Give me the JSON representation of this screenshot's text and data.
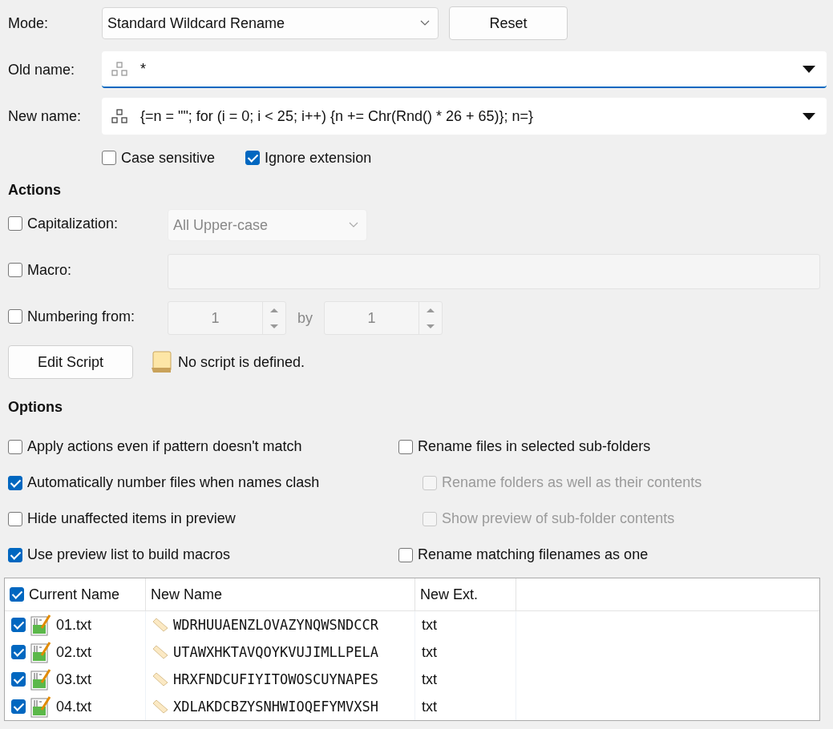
{
  "mode": {
    "label": "Mode:",
    "value": "Standard Wildcard Rename"
  },
  "reset_button": "Reset",
  "name_fields": [
    {
      "label": "Old name:",
      "value": "*",
      "focused": true
    },
    {
      "label": "New name:",
      "value": "{=n = \"\"; for (i = 0; i < 25; i++) {n += Chr(Rnd() * 26 + 65)}; n=}",
      "focused": false
    }
  ],
  "pattern_options": [
    {
      "label": "Case sensitive",
      "checked": false
    },
    {
      "label": "Ignore extension",
      "checked": true
    }
  ],
  "actions": {
    "title": "Actions",
    "capitalization": {
      "label": "Capitalization:",
      "checked": false,
      "value": "All Upper-case"
    },
    "macro": {
      "label": "Macro:",
      "checked": false
    },
    "numbering": {
      "label": "Numbering from:",
      "checked": false,
      "from": "1",
      "by_label": "by",
      "by": "1"
    },
    "edit_script_button": "Edit Script",
    "script_status": "No script is defined."
  },
  "options": {
    "title": "Options",
    "left": [
      {
        "label": "Apply actions even if pattern doesn't match",
        "checked": false,
        "disabled": false
      },
      {
        "label": "Automatically number files when names clash",
        "checked": true,
        "disabled": false
      },
      {
        "label": "Hide unaffected items in preview",
        "checked": false,
        "disabled": false
      },
      {
        "label": "Use preview list to build macros",
        "checked": true,
        "disabled": false
      }
    ],
    "right": [
      {
        "label": "Rename files in selected sub-folders",
        "checked": false,
        "disabled": false,
        "children": [
          {
            "label": "Rename folders as well as their contents",
            "checked": false,
            "disabled": true
          },
          {
            "label": "Show preview of sub-folder contents",
            "checked": false,
            "disabled": true
          }
        ]
      },
      {
        "label": "Rename matching filenames as one",
        "checked": false,
        "disabled": false
      }
    ]
  },
  "table": {
    "all_checked": true,
    "columns": [
      "Current Name",
      "New Name",
      "New Ext."
    ],
    "rows": [
      {
        "checked": true,
        "current_name": "01.txt",
        "new_name": "WDRHUUAENZLOVAZYNQWSNDCCR",
        "new_ext": "txt"
      },
      {
        "checked": true,
        "current_name": "02.txt",
        "new_name": "UTAWXHKTAVQOYKVUJIMLLPELA",
        "new_ext": "txt"
      },
      {
        "checked": true,
        "current_name": "03.txt",
        "new_name": "HRXFNDCUFIYITOWOSCUYNAPES",
        "new_ext": "txt"
      },
      {
        "checked": true,
        "current_name": "04.txt",
        "new_name": "XDLAKDCBZYSNHWIOQEFYMVXSH",
        "new_ext": "txt"
      }
    ]
  }
}
